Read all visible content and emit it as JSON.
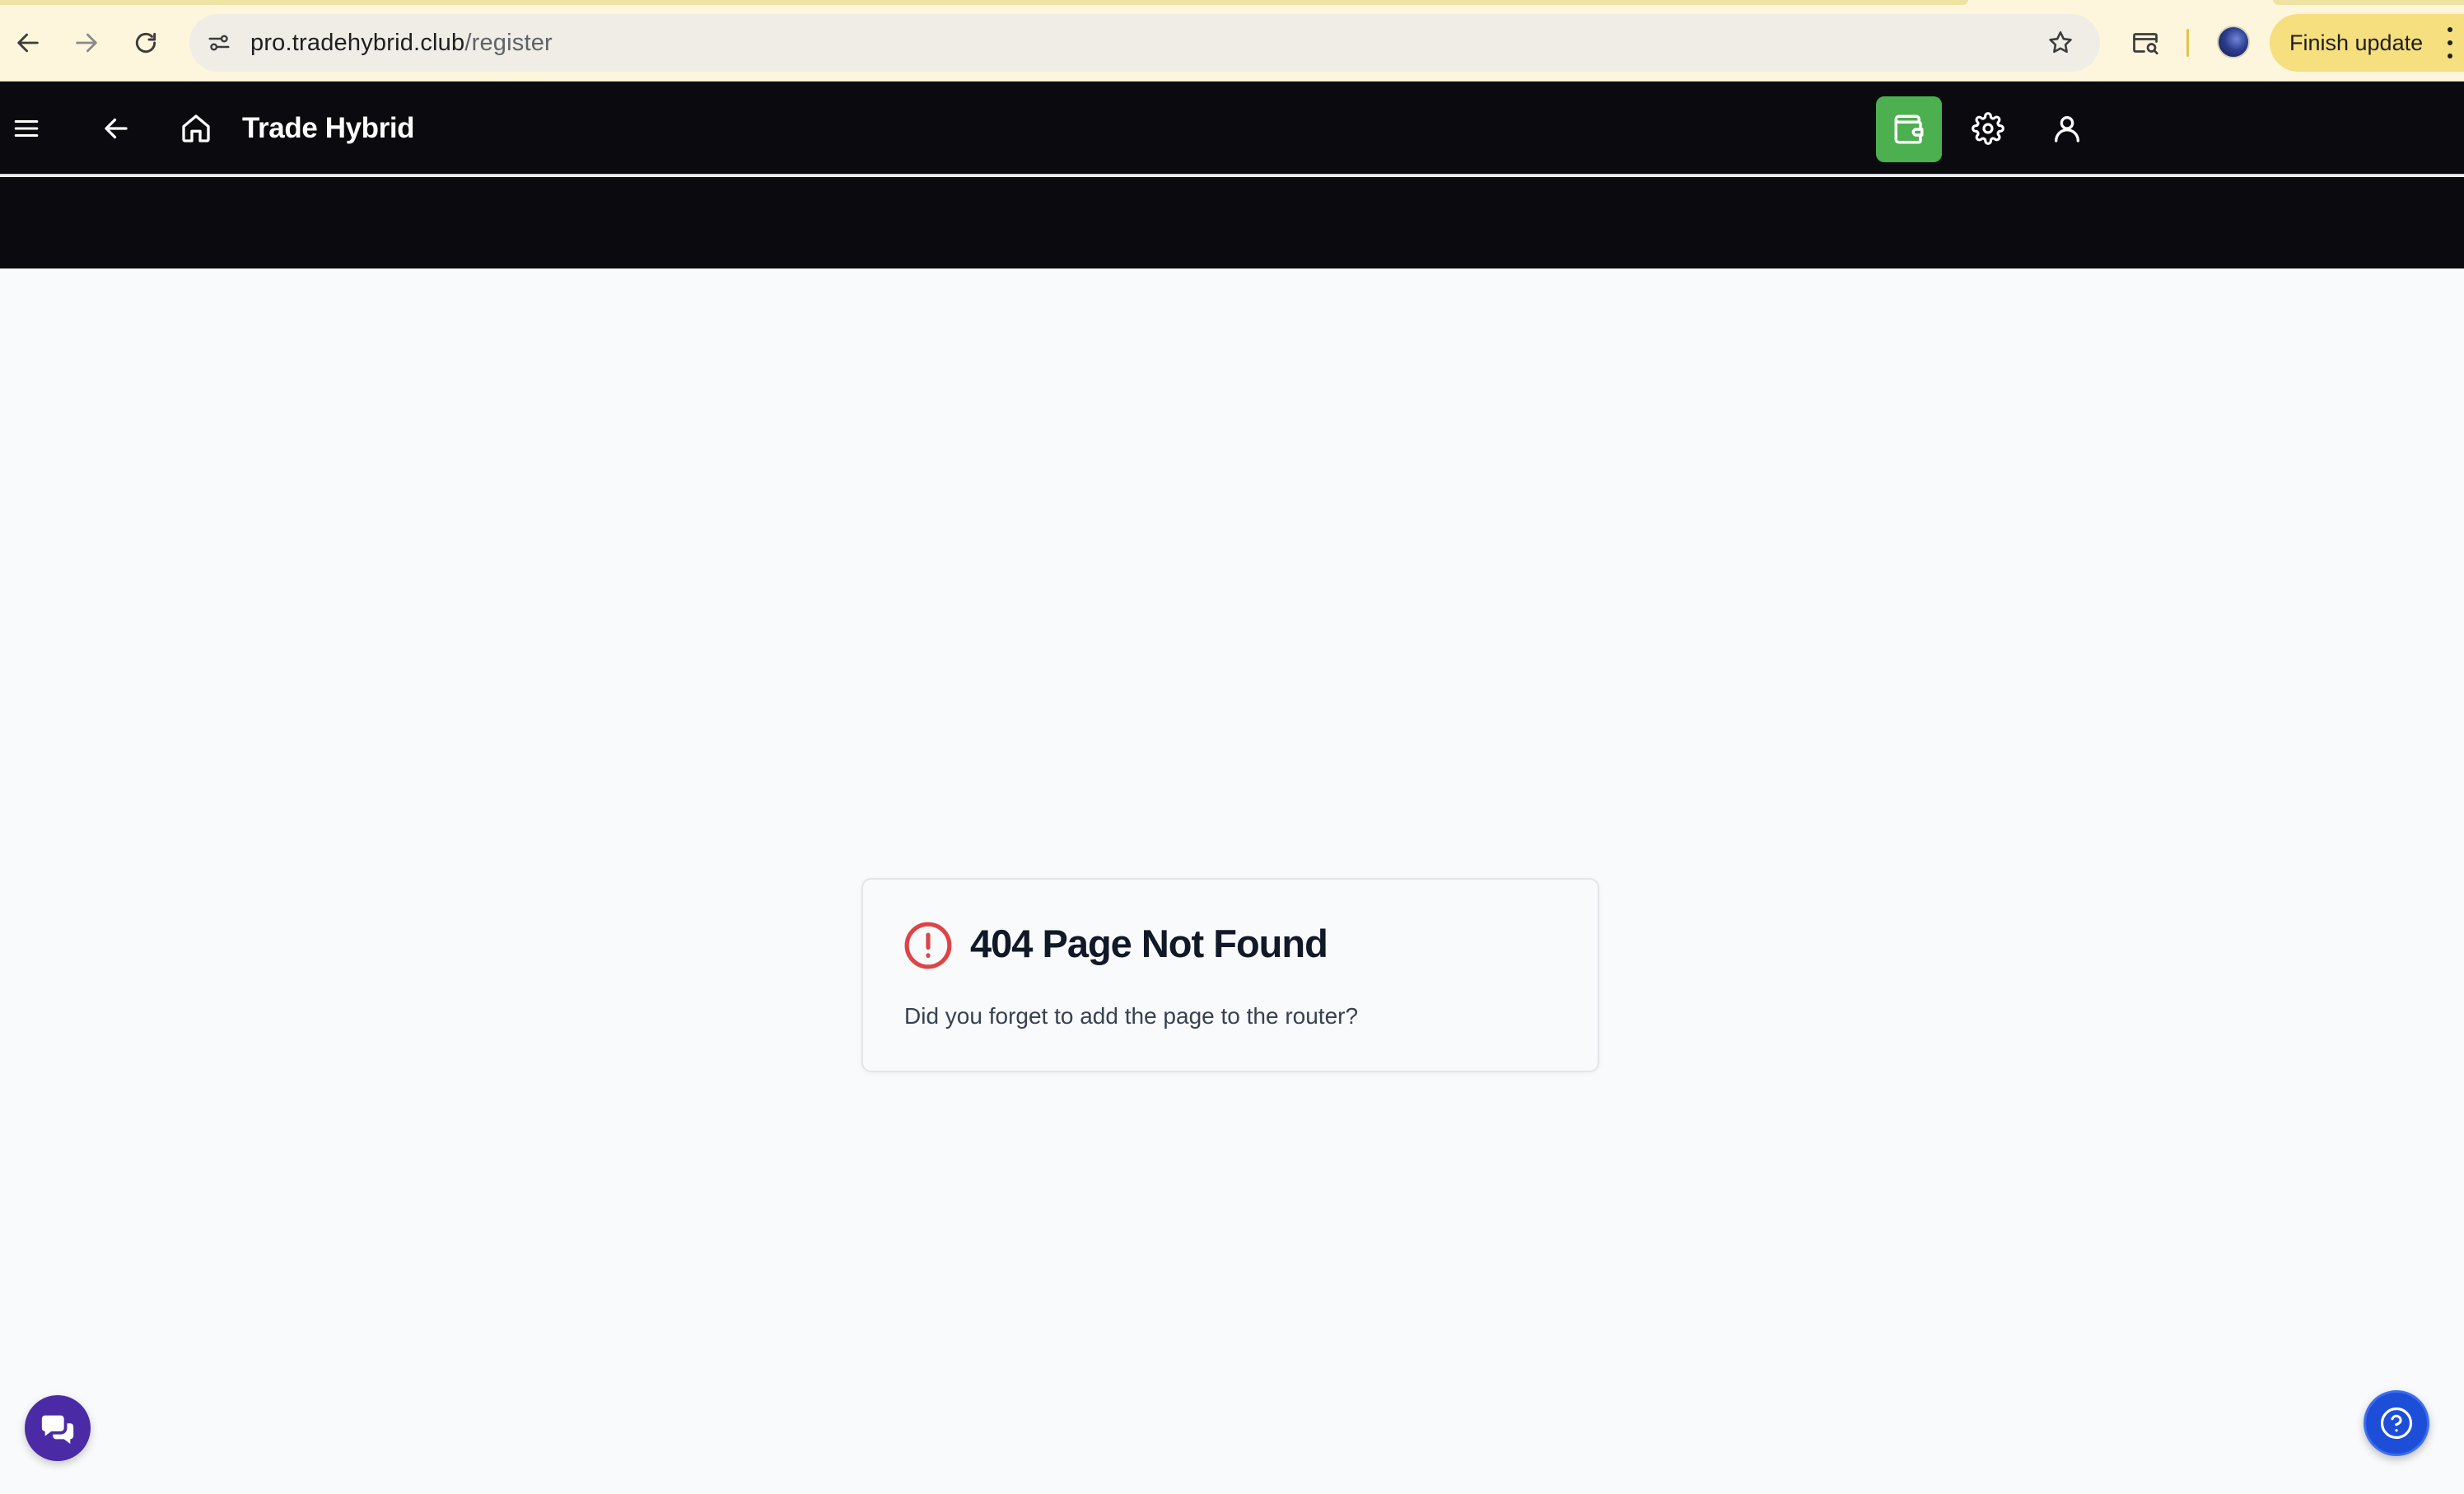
{
  "browser": {
    "url_host": "pro.tradehybrid.club",
    "url_path": "/register",
    "finish_update_label": "Finish update",
    "icons": [
      "back-arrow-icon",
      "forward-arrow-icon",
      "reload-icon",
      "site-info-icon",
      "bookmark-star-icon",
      "tab-search-icon",
      "profile-avatar",
      "more-vert-icon"
    ]
  },
  "header": {
    "title": "Trade Hybrid",
    "icons": [
      "menu-icon",
      "back-arrow-icon",
      "home-icon",
      "wallet-icon",
      "gear-icon",
      "user-icon"
    ],
    "wallet_color": "#4caf50",
    "background": "#0a0a0f"
  },
  "error": {
    "title": "404 Page Not Found",
    "message": "Did you forget to add the page to the router?",
    "icon": "alert-circle-icon",
    "icon_color": "#dc4446"
  },
  "floating": {
    "chat_icon": "chat-bubbles-icon",
    "chat_color": "#4b2aa6",
    "help_icon": "help-circle-icon",
    "help_color": "#1d4ed8"
  }
}
